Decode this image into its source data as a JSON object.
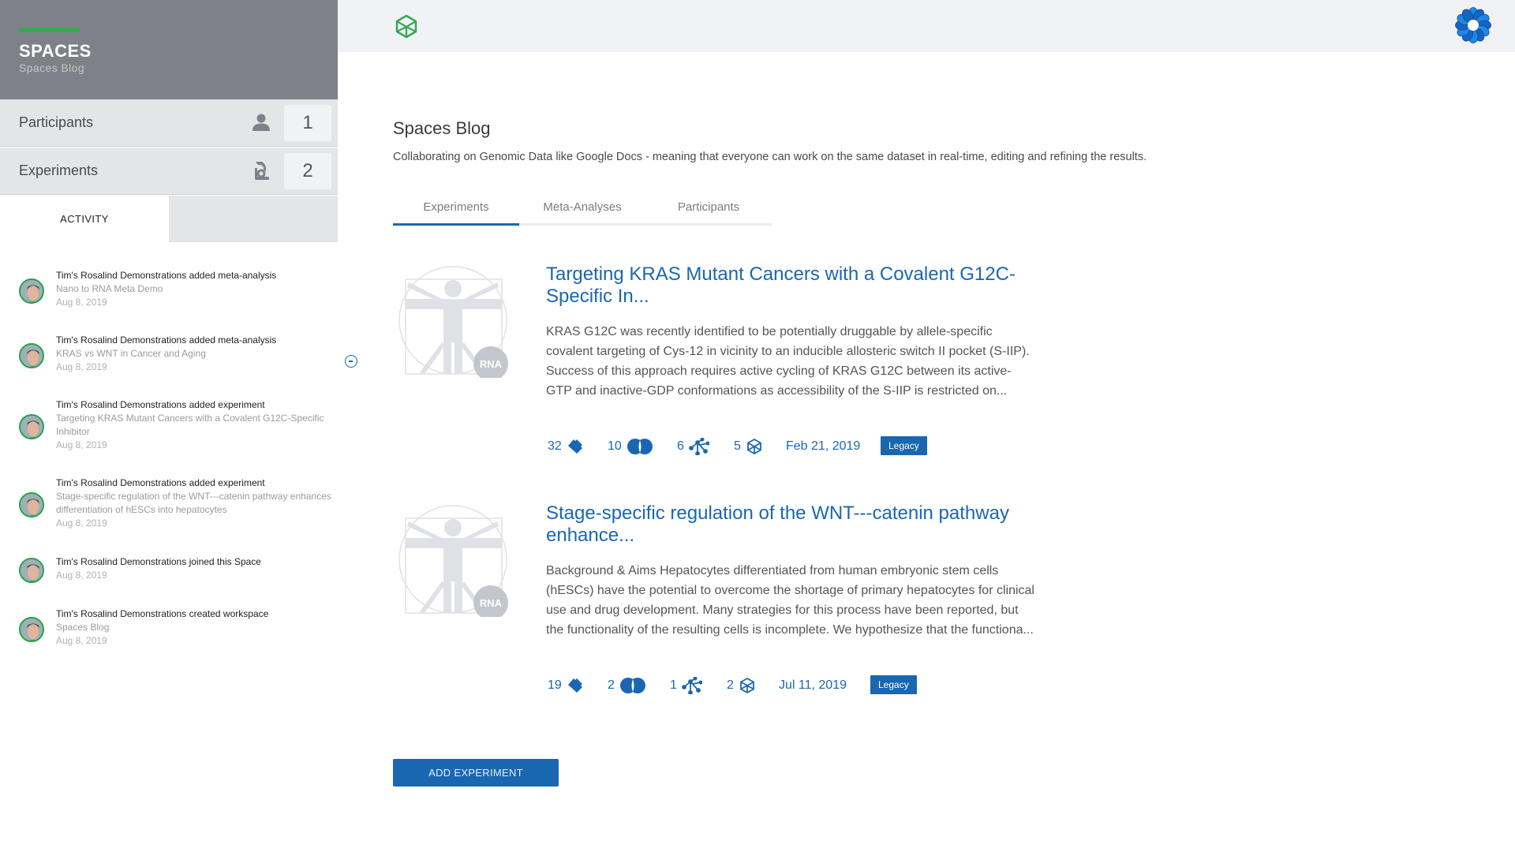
{
  "sidebar": {
    "title": "SPACES",
    "subtitle": "Spaces Blog",
    "accent_color": "#35a853",
    "stats": [
      {
        "label": "Participants",
        "icon": "person-icon",
        "count": "1"
      },
      {
        "label": "Experiments",
        "icon": "microscope-icon",
        "count": "2"
      }
    ],
    "tabs": [
      {
        "label": "ACTIVITY",
        "active": true
      },
      {
        "label": "",
        "active": false
      }
    ],
    "activity": [
      {
        "title": "Tim's Rosalind Demonstrations added meta-analysis",
        "target": "Nano to RNA Meta Demo",
        "date": "Aug 8, 2019"
      },
      {
        "title": "Tim's Rosalind Demonstrations added meta-analysis",
        "target": "KRAS vs WNT in Cancer and Aging",
        "date": "Aug 8, 2019"
      },
      {
        "title": "Tim's Rosalind Demonstrations added experiment",
        "target": "Targeting KRAS Mutant Cancers with a Covalent G12C-Specific Inhibitor",
        "date": "Aug 8, 2019"
      },
      {
        "title": "Tim's Rosalind Demonstrations added experiment",
        "target": "Stage-specific regulation of the WNT---catenin pathway enhances differentiation of hESCs into hepatocytes",
        "date": "Aug 8, 2019"
      },
      {
        "title": "Tim's Rosalind Demonstrations joined this Space",
        "target": "",
        "date": "Aug 8, 2019"
      },
      {
        "title": "Tim's Rosalind Demonstrations created workspace",
        "target": "Spaces Blog",
        "date": "Aug 8, 2019"
      }
    ]
  },
  "topbar": {
    "logo_icon": "cube-icon",
    "brand_icon": "rosalind-flower-logo"
  },
  "main": {
    "title": "Spaces Blog",
    "description": "Collaborating on Genomic Data like Google Docs - meaning that everyone can work on the same dataset in real-time, editing and refining the results.",
    "tabs": [
      {
        "label": "Experiments",
        "active": true
      },
      {
        "label": "Meta-Analyses",
        "active": false
      },
      {
        "label": "Participants",
        "active": false
      }
    ],
    "experiments": [
      {
        "title": "Targeting KRAS Mutant Cancers with a Covalent G12C-Specific In...",
        "body": "KRAS G12C was recently identified to be potentially druggable by allele-specific covalent targeting of Cys-12 in vicinity to an inducible allosteric switch II pocket (S-IIP). Success of this approach requires active cycling of KRAS G12C between its active-GTP and inactive-GDP conformations as accessibility of the S-IIP is restricted on...",
        "type_badge": "RNA",
        "samples": "32",
        "comparisons": "10",
        "analyses": "6",
        "datasets": "5",
        "date": "Feb 21, 2019",
        "tag": "Legacy"
      },
      {
        "title": "Stage-specific regulation of the WNT---catenin pathway enhance...",
        "body": "Background & Aims Hepatocytes differentiated from human embryonic stem cells (hESCs) have the potential to overcome the shortage of primary hepatocytes for clinical use and drug development. Many strategies for this process have been reported, but the functionality of the resulting cells is incomplete. We hypothesize that the functiona...",
        "type_badge": "RNA",
        "samples": "19",
        "comparisons": "2",
        "analyses": "1",
        "datasets": "2",
        "date": "Jul 11, 2019",
        "tag": "Legacy"
      }
    ],
    "add_button": "ADD EXPERIMENT",
    "accent_color": "#1a67b1"
  }
}
